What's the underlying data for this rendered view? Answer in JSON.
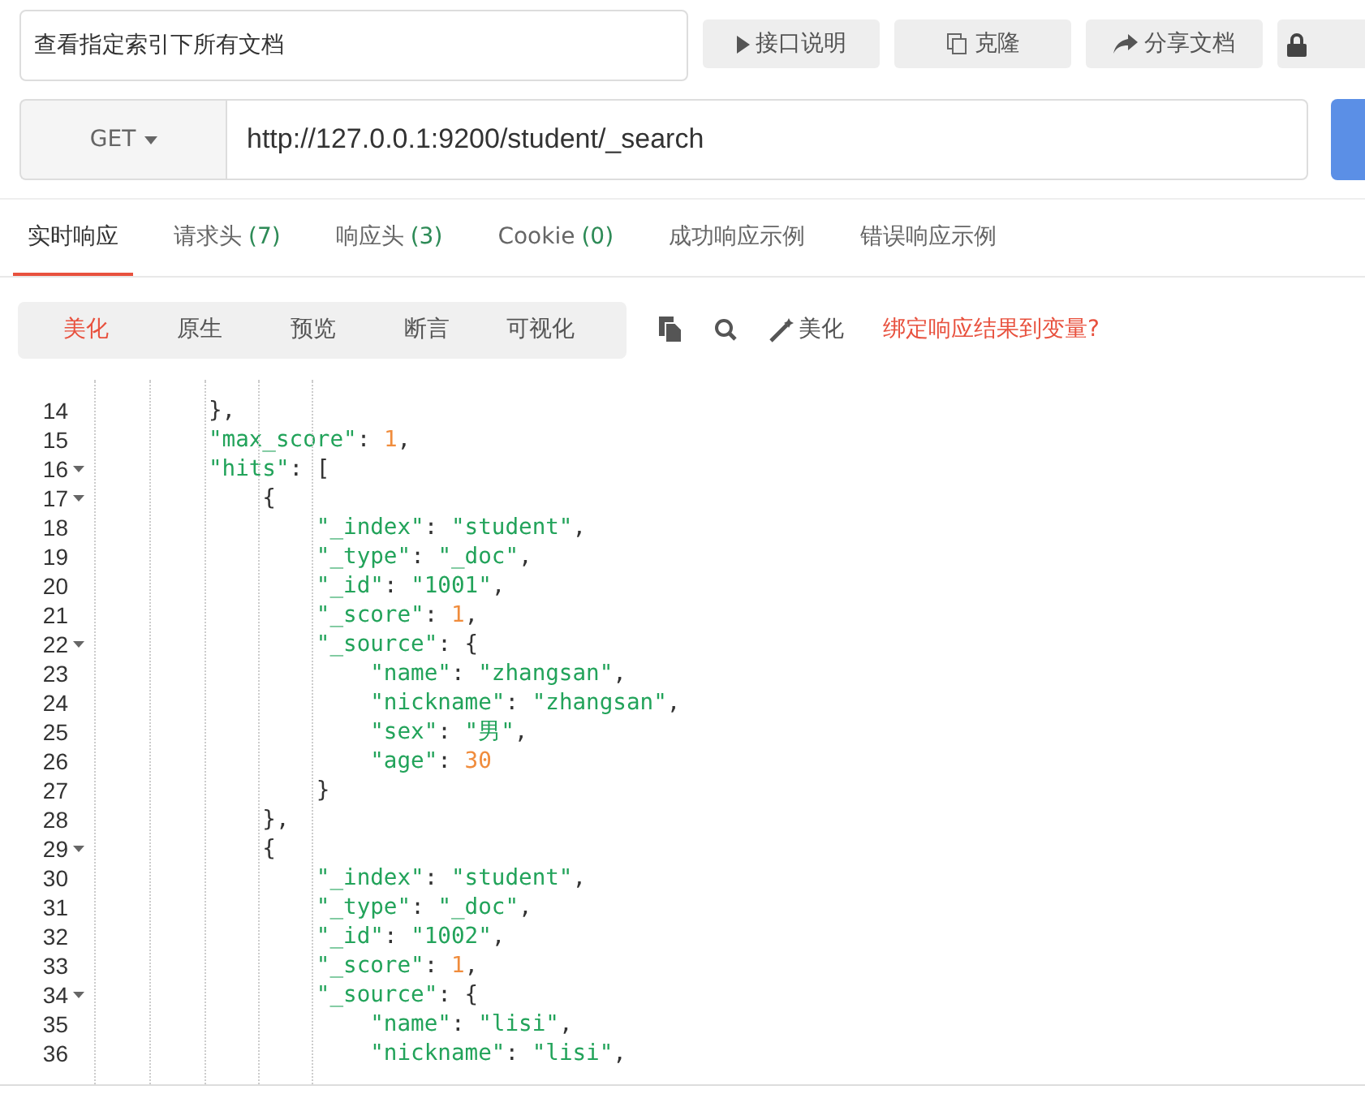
{
  "doc_name": {
    "value": "查看指定索引下所有文档"
  },
  "top_buttons": [
    {
      "kind": "play",
      "label": "接口说明"
    },
    {
      "kind": "copy",
      "label": "克隆"
    },
    {
      "kind": "share",
      "label": "分享文档"
    },
    {
      "kind": "lock"
    }
  ],
  "request": {
    "method": "GET",
    "url": "http://127.0.0.1:9200/student/_search"
  },
  "tabs": [
    {
      "label": "实时响应",
      "selected": true
    },
    {
      "label": "请求头",
      "count": "(7)",
      "selected": false
    },
    {
      "label": "响应头",
      "count": "(3)",
      "selected": false
    },
    {
      "label": "Cookie",
      "count": "(0)",
      "selected": false
    },
    {
      "label": "成功响应示例",
      "selected": false
    },
    {
      "label": "错误响应示例",
      "selected": false
    }
  ],
  "view_modes": [
    {
      "label": "美化",
      "selected": true
    },
    {
      "label": "原生",
      "selected": false
    },
    {
      "label": "预览",
      "selected": false
    },
    {
      "label": "断言",
      "selected": false
    },
    {
      "label": "可视化",
      "selected": false
    }
  ],
  "tools": [
    {
      "kind": "copy"
    },
    {
      "kind": "search"
    },
    {
      "kind": "beautify",
      "label": "美化"
    }
  ],
  "bind_link": "绑定响应结果到变量?",
  "code_lines": [
    {
      "num": "14",
      "fold": false,
      "tokens": [
        {
          "kind": "punct",
          "text": "        },"
        }
      ]
    },
    {
      "num": "15",
      "fold": false,
      "tokens": [
        {
          "kind": "key",
          "text": "        \"max_score\""
        },
        {
          "kind": "punct",
          "text": ": "
        },
        {
          "kind": "num",
          "text": "1"
        },
        {
          "kind": "punct",
          "text": ","
        }
      ]
    },
    {
      "num": "16",
      "fold": true,
      "tokens": [
        {
          "kind": "key",
          "text": "        \"hits\""
        },
        {
          "kind": "punct",
          "text": ": ["
        }
      ]
    },
    {
      "num": "17",
      "fold": true,
      "tokens": [
        {
          "kind": "punct",
          "text": "            {"
        }
      ]
    },
    {
      "num": "18",
      "fold": false,
      "tokens": [
        {
          "kind": "key",
          "text": "                \"_index\""
        },
        {
          "kind": "punct",
          "text": ": "
        },
        {
          "kind": "str",
          "text": "\"student\""
        },
        {
          "kind": "punct",
          "text": ","
        }
      ]
    },
    {
      "num": "19",
      "fold": false,
      "tokens": [
        {
          "kind": "key",
          "text": "                \"_type\""
        },
        {
          "kind": "punct",
          "text": ": "
        },
        {
          "kind": "str",
          "text": "\"_doc\""
        },
        {
          "kind": "punct",
          "text": ","
        }
      ]
    },
    {
      "num": "20",
      "fold": false,
      "tokens": [
        {
          "kind": "key",
          "text": "                \"_id\""
        },
        {
          "kind": "punct",
          "text": ": "
        },
        {
          "kind": "str",
          "text": "\"1001\""
        },
        {
          "kind": "punct",
          "text": ","
        }
      ]
    },
    {
      "num": "21",
      "fold": false,
      "tokens": [
        {
          "kind": "key",
          "text": "                \"_score\""
        },
        {
          "kind": "punct",
          "text": ": "
        },
        {
          "kind": "num",
          "text": "1"
        },
        {
          "kind": "punct",
          "text": ","
        }
      ]
    },
    {
      "num": "22",
      "fold": true,
      "tokens": [
        {
          "kind": "key",
          "text": "                \"_source\""
        },
        {
          "kind": "punct",
          "text": ": {"
        }
      ]
    },
    {
      "num": "23",
      "fold": false,
      "tokens": [
        {
          "kind": "key",
          "text": "                    \"name\""
        },
        {
          "kind": "punct",
          "text": ": "
        },
        {
          "kind": "str",
          "text": "\"zhangsan\""
        },
        {
          "kind": "punct",
          "text": ","
        }
      ]
    },
    {
      "num": "24",
      "fold": false,
      "tokens": [
        {
          "kind": "key",
          "text": "                    \"nickname\""
        },
        {
          "kind": "punct",
          "text": ": "
        },
        {
          "kind": "str",
          "text": "\"zhangsan\""
        },
        {
          "kind": "punct",
          "text": ","
        }
      ]
    },
    {
      "num": "25",
      "fold": false,
      "tokens": [
        {
          "kind": "key",
          "text": "                    \"sex\""
        },
        {
          "kind": "punct",
          "text": ": "
        },
        {
          "kind": "str",
          "text": "\"男\""
        },
        {
          "kind": "punct",
          "text": ","
        }
      ]
    },
    {
      "num": "26",
      "fold": false,
      "tokens": [
        {
          "kind": "key",
          "text": "                    \"age\""
        },
        {
          "kind": "punct",
          "text": ": "
        },
        {
          "kind": "num",
          "text": "30"
        }
      ]
    },
    {
      "num": "27",
      "fold": false,
      "tokens": [
        {
          "kind": "punct",
          "text": "                }"
        }
      ]
    },
    {
      "num": "28",
      "fold": false,
      "tokens": [
        {
          "kind": "punct",
          "text": "            },"
        }
      ]
    },
    {
      "num": "29",
      "fold": true,
      "tokens": [
        {
          "kind": "punct",
          "text": "            {"
        }
      ]
    },
    {
      "num": "30",
      "fold": false,
      "tokens": [
        {
          "kind": "key",
          "text": "                \"_index\""
        },
        {
          "kind": "punct",
          "text": ": "
        },
        {
          "kind": "str",
          "text": "\"student\""
        },
        {
          "kind": "punct",
          "text": ","
        }
      ]
    },
    {
      "num": "31",
      "fold": false,
      "tokens": [
        {
          "kind": "key",
          "text": "                \"_type\""
        },
        {
          "kind": "punct",
          "text": ": "
        },
        {
          "kind": "str",
          "text": "\"_doc\""
        },
        {
          "kind": "punct",
          "text": ","
        }
      ]
    },
    {
      "num": "32",
      "fold": false,
      "tokens": [
        {
          "kind": "key",
          "text": "                \"_id\""
        },
        {
          "kind": "punct",
          "text": ": "
        },
        {
          "kind": "str",
          "text": "\"1002\""
        },
        {
          "kind": "punct",
          "text": ","
        }
      ]
    },
    {
      "num": "33",
      "fold": false,
      "tokens": [
        {
          "kind": "key",
          "text": "                \"_score\""
        },
        {
          "kind": "punct",
          "text": ": "
        },
        {
          "kind": "num",
          "text": "1"
        },
        {
          "kind": "punct",
          "text": ","
        }
      ]
    },
    {
      "num": "34",
      "fold": true,
      "tokens": [
        {
          "kind": "key",
          "text": "                \"_source\""
        },
        {
          "kind": "punct",
          "text": ": {"
        }
      ]
    },
    {
      "num": "35",
      "fold": false,
      "tokens": [
        {
          "kind": "key",
          "text": "                    \"name\""
        },
        {
          "kind": "punct",
          "text": ": "
        },
        {
          "kind": "str",
          "text": "\"lisi\""
        },
        {
          "kind": "punct",
          "text": ","
        }
      ]
    },
    {
      "num": "36",
      "fold": false,
      "tokens": [
        {
          "kind": "key",
          "text": "                    \"nickname\""
        },
        {
          "kind": "punct",
          "text": ": "
        },
        {
          "kind": "str",
          "text": "\"lisi\""
        },
        {
          "kind": "punct",
          "text": ","
        }
      ]
    }
  ]
}
